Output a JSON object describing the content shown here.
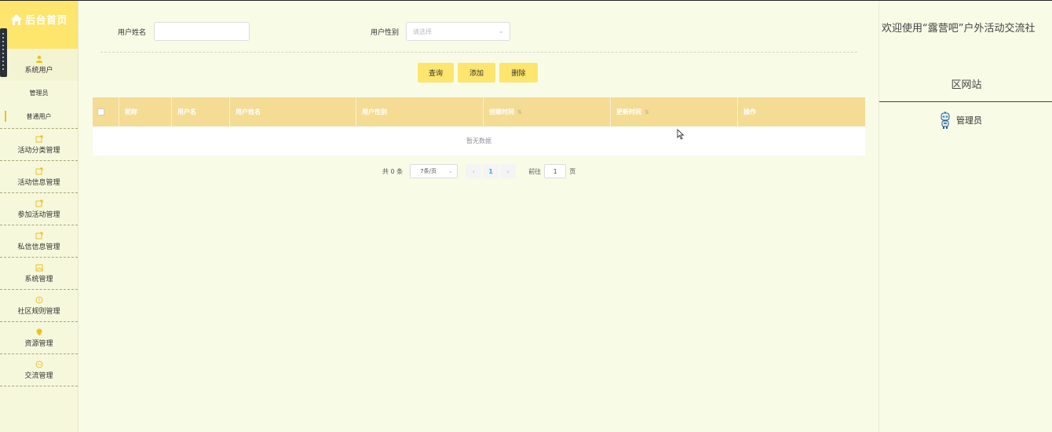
{
  "sidebar": {
    "home_label": "后台首页",
    "groups": [
      {
        "label": "系统用户",
        "icon": "user-icon",
        "subitems": [
          "管理员",
          "普通用户"
        ]
      },
      {
        "label": "活动分类管理",
        "icon": "edit-icon"
      },
      {
        "label": "活动信息管理",
        "icon": "edit-icon"
      },
      {
        "label": "参加活动管理",
        "icon": "edit-icon"
      },
      {
        "label": "私信信息管理",
        "icon": "edit-icon"
      },
      {
        "label": "系统管理",
        "icon": "image-icon"
      },
      {
        "label": "社区规则管理",
        "icon": "info-icon"
      },
      {
        "label": "资源管理",
        "icon": "location-icon"
      },
      {
        "label": "交流管理",
        "icon": "chat-icon"
      }
    ]
  },
  "search": {
    "name_label": "用户姓名",
    "name_value": "",
    "gender_label": "用户性别",
    "gender_placeholder": "请选择"
  },
  "actions": {
    "query": "查询",
    "add": "添加",
    "delete": "删除"
  },
  "table": {
    "columns": [
      "昵称",
      "用户名",
      "用户姓名",
      "用户性别",
      "创建时间",
      "更新时间",
      "操作"
    ],
    "empty_text": "暂无数据"
  },
  "pagination": {
    "total_text": "共 0 条",
    "page_size": "7条/页",
    "current_page": "1",
    "goto_label": "前往",
    "goto_value": "1",
    "page_unit": "页"
  },
  "right": {
    "welcome_line1": "欢迎使用“露营吧”户外活动交流社",
    "welcome_line2": "区网站",
    "user_name": "管理员"
  },
  "colors": {
    "accent": "#fde56e",
    "table_header": "#f4dc94",
    "background": "#f8fbe6"
  }
}
